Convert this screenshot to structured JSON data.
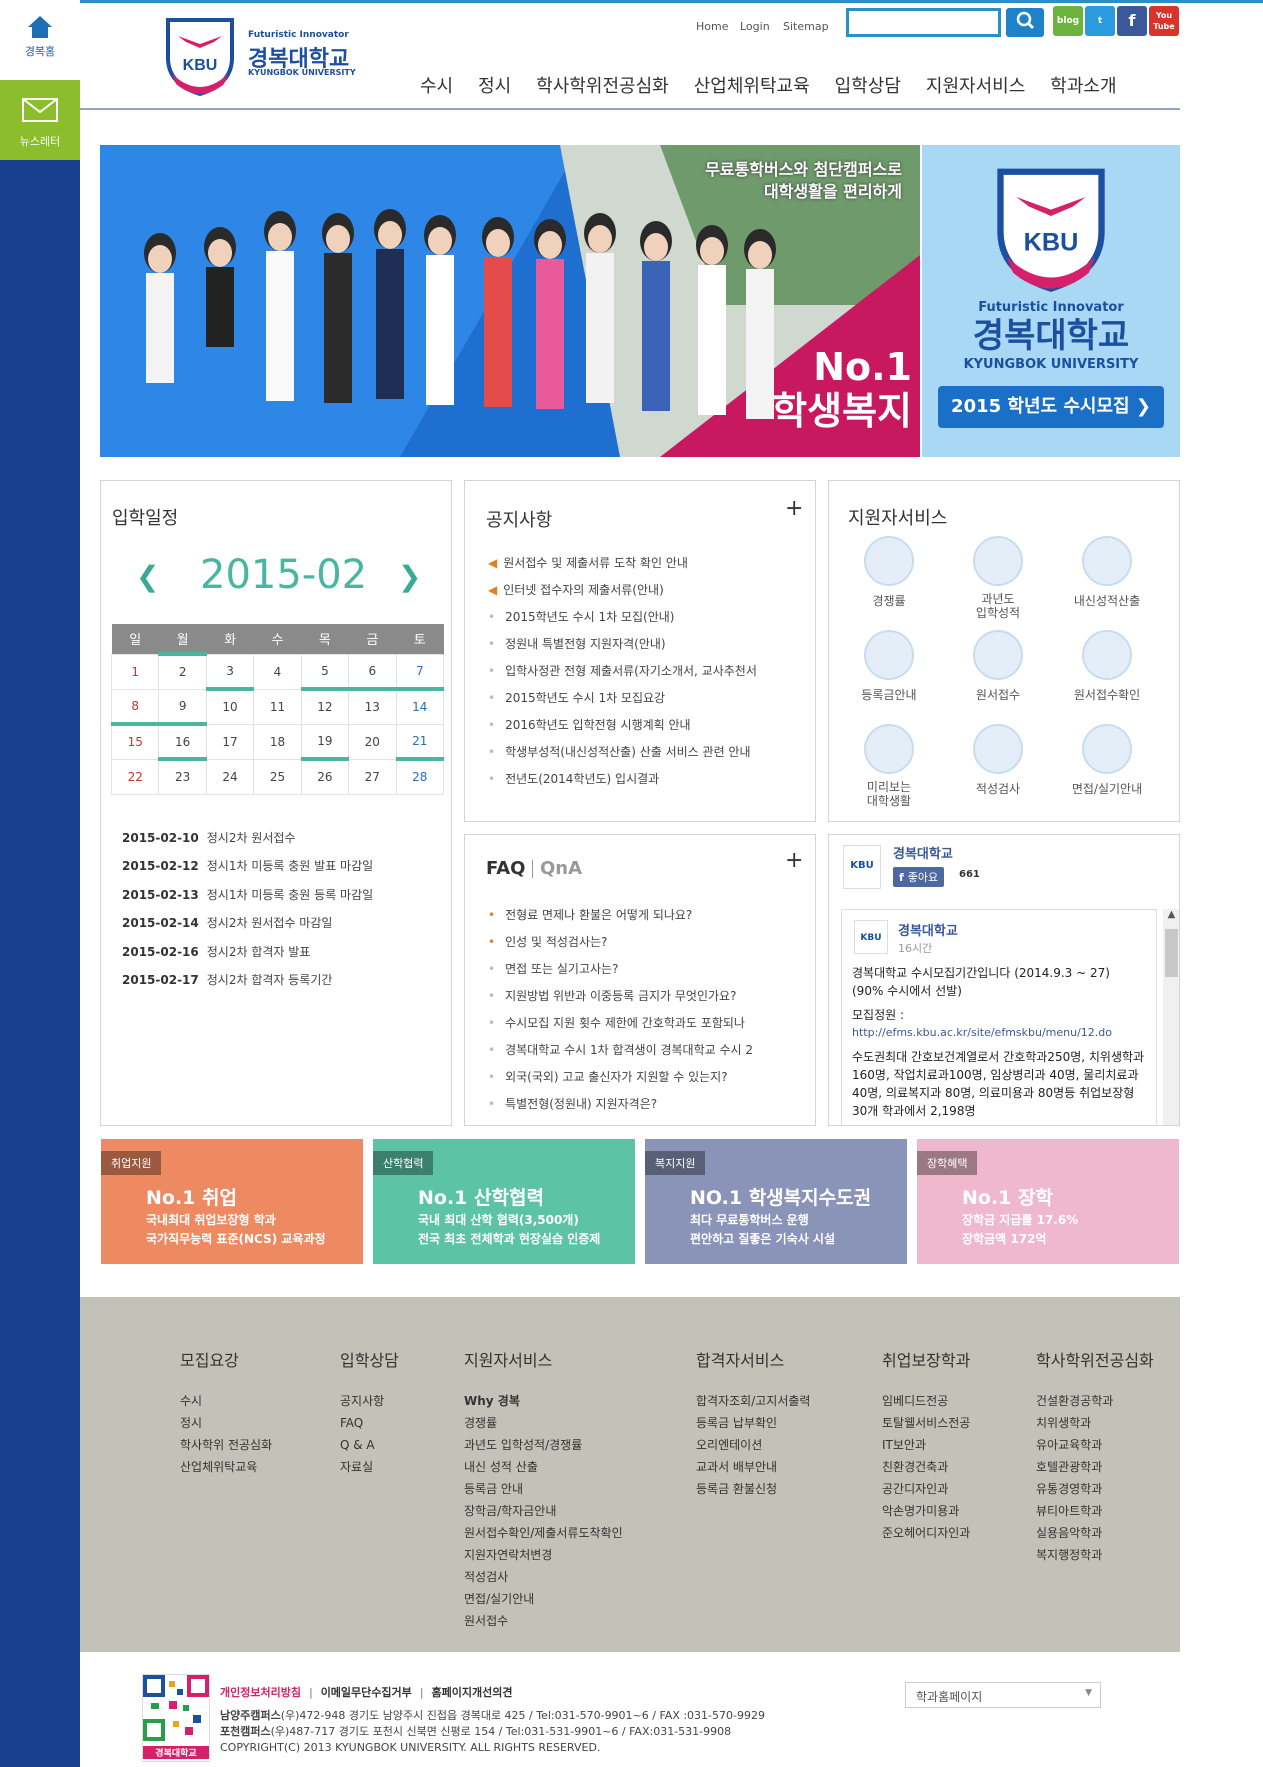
{
  "leftbar": {
    "home_label": "경복홈",
    "news_label": "뉴스레터"
  },
  "header": {
    "logo_tagline": "Futuristic Innovator",
    "logo_name": "경복대학교",
    "logo_en": "KYUNGBOK UNIVERSITY",
    "logo_mark": "KBU",
    "top_links": [
      "Home",
      "Login",
      "Sitemap"
    ],
    "search_placeholder": "",
    "sns": [
      "blog",
      "t",
      "f",
      "You Tube"
    ],
    "gnb": [
      "수시",
      "정시",
      "학사학위전공심화",
      "산업체위탁교육",
      "입학상담",
      "지원자서비스",
      "학과소개"
    ]
  },
  "banner": {
    "line1": "무료통학버스와 첨단캠퍼스로",
    "line2": "대학생활을 편리하게",
    "big1": "No.1",
    "big2": "학생복지",
    "side_tagline": "Futuristic Innovator",
    "side_name": "경복대학교",
    "side_en": "KYUNGBOK UNIVERSITY",
    "side_button": "2015 학년도 수시모집 ❯"
  },
  "schedule": {
    "title": "입학일정",
    "month": "2015-02",
    "weekdays": [
      "일",
      "월",
      "화",
      "수",
      "목",
      "금",
      "토"
    ],
    "weeks": [
      [
        "1",
        "2",
        "3",
        "4",
        "5",
        "6",
        "7"
      ],
      [
        "8",
        "9",
        "10",
        "11",
        "12",
        "13",
        "14"
      ],
      [
        "15",
        "16",
        "17",
        "18",
        "19",
        "20",
        "21"
      ],
      [
        "22",
        "23",
        "24",
        "25",
        "26",
        "27",
        "28"
      ]
    ],
    "items": [
      {
        "date": "2015-02-10",
        "text": "정시2차 원서접수"
      },
      {
        "date": "2015-02-12",
        "text": "정시1차 미등록 충원 발표 마감일"
      },
      {
        "date": "2015-02-13",
        "text": "정시1차 미등록 충원 등록 마감일"
      },
      {
        "date": "2015-02-14",
        "text": "정시2차 원서접수 마감일"
      },
      {
        "date": "2015-02-16",
        "text": "정시2차 합격자 발표"
      },
      {
        "date": "2015-02-17",
        "text": "정시2차 합격자 등록기간"
      }
    ]
  },
  "notice": {
    "title": "공지사항",
    "plus": "+",
    "items": [
      "원서접수 및 제출서류 도착 확인 안내",
      "인터넷 접수자의 제출서류(안내)",
      "2015학년도 수시 1차 모집(안내)",
      "정원내 특별전형 지원자격(안내)",
      "입학사정관 전형 제출서류(자기소개서, 교사추천서",
      "2015학년도 수시 1차 모집요강",
      "2016학년도 입학전형 시행계획 안내",
      "학생부성적(내신성적산출) 산출 서비스 관련 안내",
      "전년도(2014학년도) 입시결과"
    ]
  },
  "services": {
    "title": "지원자서비스",
    "items": [
      "경쟁률",
      "과년도\n입학성적",
      "내신성적산출",
      "등록금안내",
      "원서접수",
      "원서접수확인",
      "미리보는\n대학생활",
      "적성검사",
      "면접/실기안내"
    ]
  },
  "faq": {
    "title": "FAQ",
    "tab2": "QnA",
    "plus": "+",
    "items": [
      "전형료 면제나 환불은 어떻게 되나요?",
      "인성 및 적성검사는?",
      "면접 또는 실기고사는?",
      "지원방법 위반과 이중등록 금지가 무엇인가요?",
      "수시모집 지원 횟수 제한에 간호학과도 포함되나",
      "경복대학교 수시 1차 합격생이 경복대학교 수시 2",
      "외국(국외) 고교 출신자가 지원할 수 있는지?",
      "특별전형(정원내) 지원자격은?"
    ]
  },
  "facebook": {
    "page_name": "경복대학교",
    "like_label": "좋아요",
    "like_count": "661",
    "post_author": "경복대학교",
    "post_time": "16시간",
    "post_line1": "경복대학교 수시모집기간입니다 (2014.9.3 ~ 27)",
    "post_line2": "(90% 수시에서 선발)",
    "post_line3": "모집정원 :",
    "post_link": "http://efms.kbu.ac.kr/site/efmskbu/menu/12.do",
    "post_body": "수도권최대 간호보건계열로서 간호학과250명, 치위생학과 160명, 작업치료과100명, 임상병리과 40명, 물리치료과 40명, 의료복지과 80명, 의료미용과 80명등 취업보장형 30개 학과에서 2,198명"
  },
  "promos": [
    {
      "tag": "취업지원",
      "head": "No.1 취업",
      "line1": "국내최대 취업보장형 학과",
      "line2": "국가직무능력 표준(NCS) 교육과정",
      "color": "#ee8a62"
    },
    {
      "tag": "산학협력",
      "head": "No.1 산학협력",
      "line1": "국내 최대 산학 협력(3,500개)",
      "line2": "전국 최초 전체학과 현장실습 인증제",
      "color": "#5cc4a3"
    },
    {
      "tag": "복지지원",
      "head": "NO.1 학생복지수도권",
      "line1": "최다 무료통학버스 운행",
      "line2": "편안하고 질좋은 기숙사 시설",
      "color": "#8a93b8"
    },
    {
      "tag": "장학혜택",
      "head": "No.1 장학",
      "line1": "장학금 지급률 17.6%",
      "line2": "장학금액 172억",
      "color": "#f0b8cc"
    }
  ],
  "footer_cols": [
    {
      "title": "모집요강",
      "items": [
        "수시",
        "정시",
        "학사학위 전공심화",
        "산업체위탁교육"
      ]
    },
    {
      "title": "입학상담",
      "items": [
        "공지사항",
        "FAQ",
        "Q & A",
        "자료실"
      ]
    },
    {
      "title": "지원자서비스",
      "items": [
        "Why 경복",
        "경쟁률",
        "과년도 입학성적/경쟁률",
        "내신 성적 산출",
        "등록금 안내",
        "장학금/학자금안내",
        "원서접수확인/제출서류도착확인",
        "지원자연락처변경",
        "적성검사",
        "면접/실기안내",
        "원서접수"
      ]
    },
    {
      "title": "합격자서비스",
      "items": [
        "합격자조회/고지서출력",
        "등록금 납부확인",
        "오리엔테이션",
        "교과서 배부안내",
        "등록금 환불신청"
      ]
    },
    {
      "title": "취업보장학과",
      "items": [
        "임베디드전공",
        "토탈웰서비스전공",
        "IT보안과",
        "친환경건축과",
        "공간디자인과",
        "악손명가미용과",
        "준오헤어디자인과"
      ]
    },
    {
      "title": "학사학위전공심화",
      "items": [
        "건설환경공학과",
        "치위생학과",
        "유아교육학과",
        "호텔관광학과",
        "유통경영학과",
        "뷰티아트학과",
        "실용음악학과",
        "복지행정학과"
      ]
    }
  ],
  "bottom": {
    "links": [
      "개인정보처리방침",
      "이메일무단수집거부",
      "홈페이지개선의견"
    ],
    "addr1_bold": "남양주캠퍼스",
    "addr1": "(우)472-948 경기도 남양주시 진접읍 경복대로 425 / Tel:031-570-9901~6 / FAX :031-570-9929",
    "addr2_bold": "포천캠퍼스",
    "addr2": "(우)487-717 경기도 포천시 신북면 신평로 154 / Tel:031-531-9901~6 / FAX:031-531-9908",
    "copyright": "COPYRIGHT(C) 2013 KYUNGBOK UNIVERSITY. ALL RIGHTS RESERVED.",
    "qr_label": "경복대학교",
    "select_value": "학과홈페이지"
  }
}
